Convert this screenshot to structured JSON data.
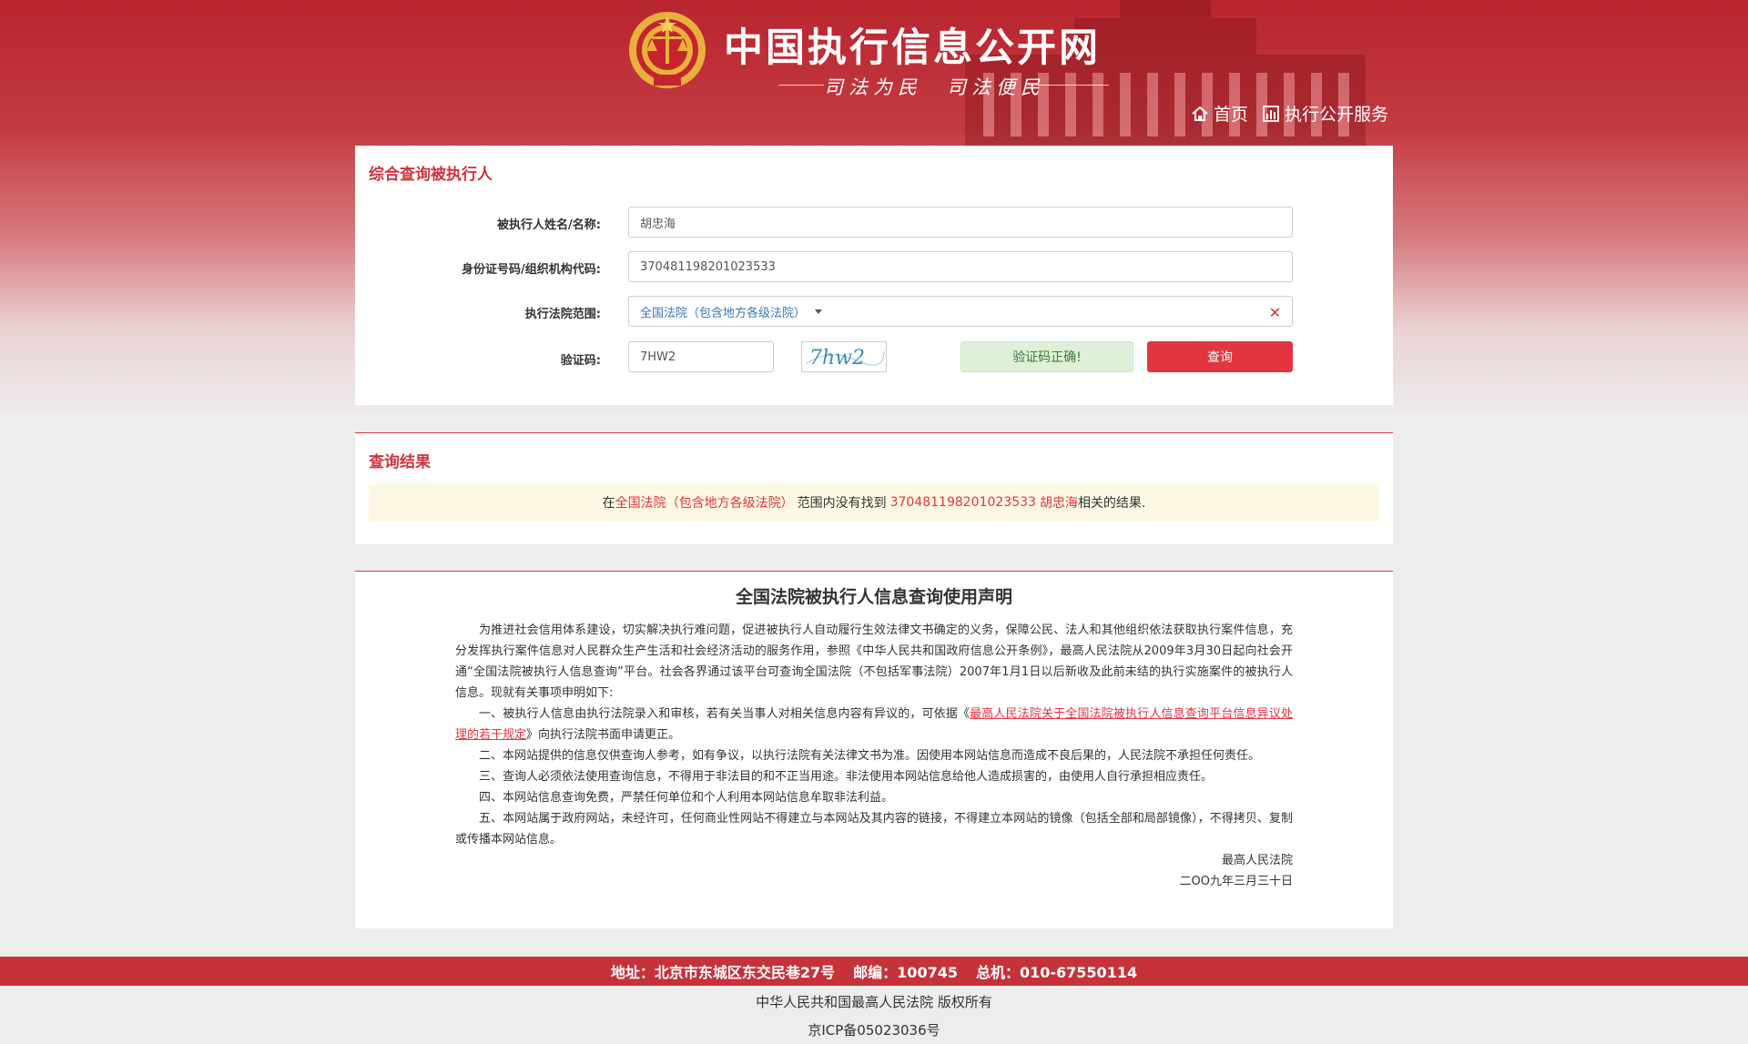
{
  "header": {
    "site_title": "中国执行信息公开网",
    "slogan": "司法为民　司法便民",
    "nav": [
      {
        "label": "首页",
        "icon": "home-icon"
      },
      {
        "label": "执行公开服务",
        "icon": "bar-chart-icon"
      }
    ]
  },
  "search_panel": {
    "title": "综合查询被执行人",
    "name_label": "被执行人姓名/名称:",
    "name_value": "胡忠海",
    "id_label": "身份证号码/组织机构代码:",
    "id_value": "370481198201023533",
    "court_label": "执行法院范围:",
    "court_value": "全国法院（包含地方各级法院）",
    "captcha_label": "验证码:",
    "captcha_value": "7HW2",
    "captcha_image_text": "7hw2",
    "captcha_status": "验证码正确!",
    "query_button": "查询"
  },
  "result_panel": {
    "title": "查询结果",
    "msg_prefix": "在",
    "msg_court": "全国法院（包含地方各级法院）",
    "msg_mid": "范围内没有找到",
    "msg_id": "370481198201023533",
    "msg_name": "胡忠海",
    "msg_suffix": "相关的结果."
  },
  "declaration": {
    "title": "全国法院被执行人信息查询使用声明",
    "p_intro": "为推进社会信用体系建设，切实解决执行难问题，促进被执行人自动履行生效法律文书确定的义务，保障公民、法人和其他组织依法获取执行案件信息，充分发挥执行案件信息对人民群众生产生活和社会经济活动的服务作用，参照《中华人民共和国政府信息公开条例》，最高人民法院从2009年3月30日起向社会开通“全国法院被执行人信息查询”平台。社会各界通过该平台可查询全国法院（不包括军事法院）2007年1月1日以后新收及此前未结的执行实施案件的被执行人信息。现就有关事项申明如下:",
    "p1_before": "一、被执行人信息由执行法院录入和审核，若有关当事人对相关信息内容有异议的，可依据《",
    "p1_link": "最高人民法院关于全国法院被执行人信息查询平台信息异议处理的若干规定",
    "p1_after": "》向执行法院书面申请更正。",
    "p2": "二、本网站提供的信息仅供查询人参考，如有争议，以执行法院有关法律文书为准。因使用本网站信息而造成不良后果的，人民法院不承担任何责任。",
    "p3": "三、查询人必须依法使用查询信息，不得用于非法目的和不正当用途。非法使用本网站信息给他人造成损害的，由使用人自行承担相应责任。",
    "p4": "四、本网站信息查询免费，严禁任何单位和个人利用本网站信息牟取非法利益。",
    "p5": "五、本网站属于政府网站，未经许可，任何商业性网站不得建立与本网站及其内容的链接，不得建立本网站的镜像（包括全部和局部镜像），不得拷贝、复制或传播本网站信息。",
    "signature": "最高人民法院",
    "date": "二OO九年三月三十日"
  },
  "footer": {
    "address": "地址：北京市东城区东交民巷27号",
    "postcode": "邮编：100745",
    "phone": "总机：010-67550114",
    "copyright": "中华人民共和国最高人民法院 版权所有",
    "icp": "京ICP备05023036号"
  },
  "colors": {
    "brand_red": "#c6323a",
    "accent_red": "#e1363f",
    "ok_green_bg": "#dff0d8",
    "result_bg": "#fcf8e3"
  }
}
